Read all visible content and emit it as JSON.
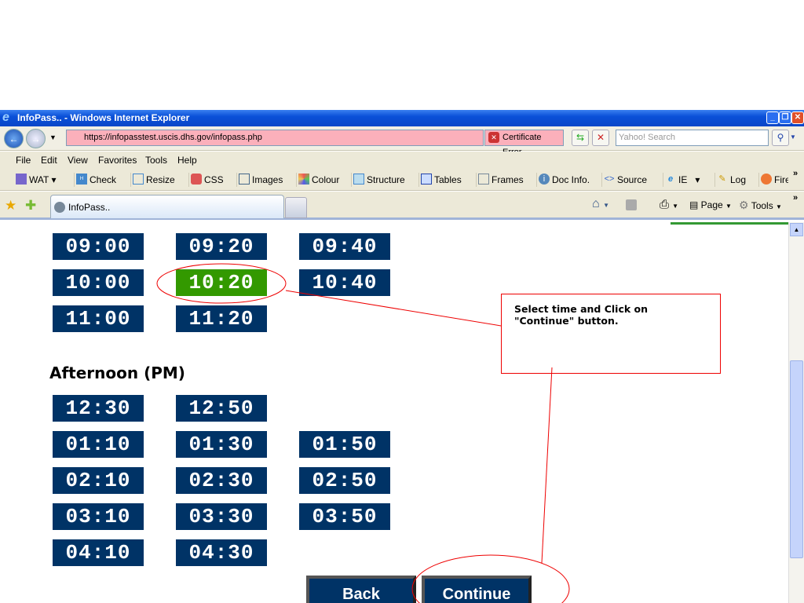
{
  "window": {
    "title": "InfoPass.. - Windows Internet Explorer"
  },
  "address": {
    "url": "https://infopasstest.uscis.dhs.gov/infopass.php",
    "cert_error": "Certificate Error",
    "search_placeholder": "Yahoo! Search"
  },
  "menu": [
    "File",
    "Edit",
    "View",
    "Favorites",
    "Tools",
    "Help"
  ],
  "toolbar": [
    {
      "label": "WAT",
      "icon": "wat-icon"
    },
    {
      "label": "Check",
      "icon": "html-check-icon"
    },
    {
      "label": "Resize",
      "icon": "resize-icon"
    },
    {
      "label": "CSS",
      "icon": "css-icon"
    },
    {
      "label": "Images",
      "icon": "images-icon"
    },
    {
      "label": "Colour",
      "icon": "colour-icon"
    },
    {
      "label": "Structure",
      "icon": "structure-icon"
    },
    {
      "label": "Tables",
      "icon": "tables-icon"
    },
    {
      "label": "Frames",
      "icon": "frames-icon"
    },
    {
      "label": "Doc Info.",
      "icon": "info-icon"
    },
    {
      "label": "Source",
      "icon": "source-icon"
    },
    {
      "label": "IE",
      "icon": "ie-icon"
    },
    {
      "label": "Log",
      "icon": "log-icon"
    },
    {
      "label": "Fire",
      "icon": "firefox-icon"
    }
  ],
  "tab": {
    "label": "InfoPass.."
  },
  "command_bar": {
    "page": "Page",
    "tools": "Tools"
  },
  "morning_slots": [
    "09:00",
    "09:20",
    "09:40",
    "10:00",
    "10:20",
    "10:40",
    "11:00",
    "11:20"
  ],
  "selected_slot": "10:20",
  "afternoon_heading": "Afternoon (PM)",
  "afternoon_slots": [
    [
      "12:30",
      "12:50",
      null
    ],
    [
      "01:10",
      "01:30",
      "01:50"
    ],
    [
      "02:10",
      "02:30",
      "02:50"
    ],
    [
      "03:10",
      "03:30",
      "03:50"
    ],
    [
      "04:10",
      "04:30",
      null
    ]
  ],
  "buttons": {
    "back": "Back",
    "continue": "Continue"
  },
  "callout": "Select time and Click on \"Continue\" button.",
  "colors": {
    "slot": "#003366",
    "selected": "#339900",
    "annotation": "#e00000"
  }
}
